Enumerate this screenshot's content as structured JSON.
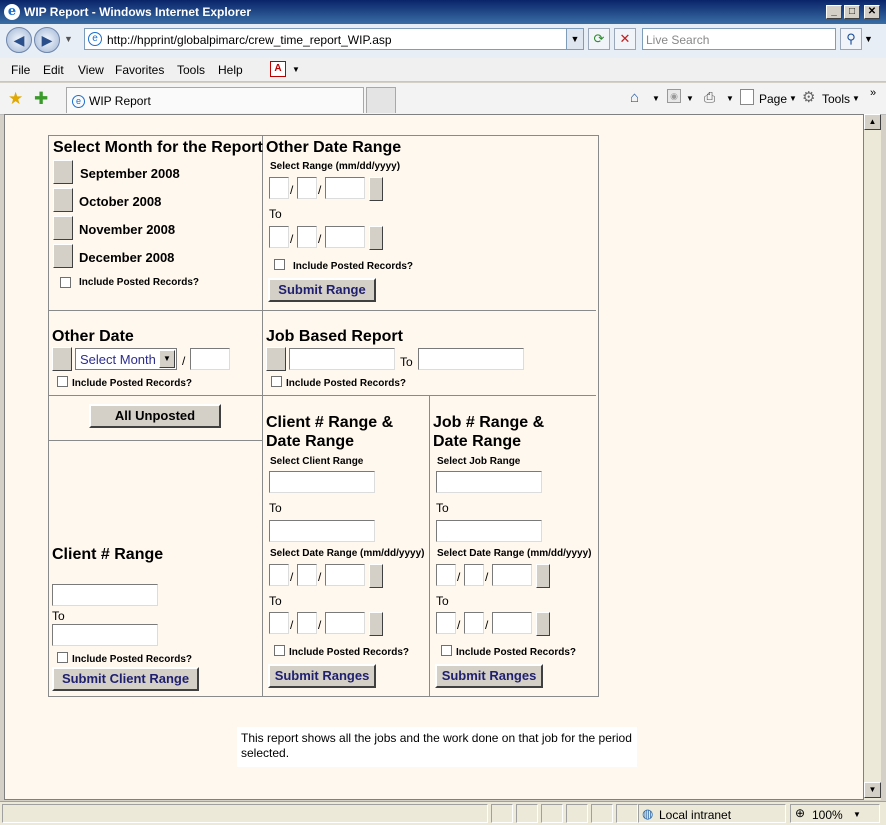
{
  "window": {
    "title": "WIP Report - Windows Internet Explorer"
  },
  "nav": {
    "url": "http://hpprint/globalpimarc/crew_time_report_WIP.asp",
    "search_placeholder": "Live Search"
  },
  "menu": [
    "File",
    "Edit",
    "View",
    "Favorites",
    "Tools",
    "Help"
  ],
  "tab": {
    "label": "WIP Report"
  },
  "toolbar": {
    "page": "Page",
    "tools": "Tools"
  },
  "status": {
    "zone": "Local intranet",
    "zoom": "100%"
  },
  "month_section": {
    "title": "Select Month for the Report",
    "months": [
      "September  2008",
      "October  2008",
      "November  2008",
      "December  2008"
    ],
    "include_posted": "Include Posted Records?"
  },
  "other_range": {
    "title": "Other Date Range",
    "select_label": "Select Range (mm/dd/yyyy)",
    "to": "To",
    "include_posted": "Include Posted Records?",
    "submit": "Submit Range"
  },
  "other_date": {
    "title": "Other Date",
    "select_month": "Select Month",
    "slash": "/",
    "include_posted": "Include Posted Records?"
  },
  "job_based": {
    "title": "Job Based Report",
    "to": "To",
    "include_posted": "Include Posted Records?"
  },
  "all_unposted": {
    "label": "All Unposted"
  },
  "client_range_date": {
    "title_1": "Client # Range &",
    "title_2": "Date Range",
    "select_client": "Select Client Range",
    "to": "To",
    "select_date": "Select Date Range (mm/dd/yyyy)",
    "include_posted": "Include Posted Records?",
    "submit": "Submit Ranges"
  },
  "job_range_date": {
    "title_1": "Job # Range &",
    "title_2": "Date Range",
    "select_job": "Select Job Range",
    "to": "To",
    "select_date": "Select Date Range (mm/dd/yyyy)",
    "include_posted": "Include Posted Records?",
    "submit": "Submit Ranges"
  },
  "client_range": {
    "title": "Client # Range",
    "to": "To",
    "include_posted": "Include Posted Records?",
    "submit": "Submit Client Range"
  },
  "note": "This report shows all the jobs and the work done on that job for the period selected."
}
